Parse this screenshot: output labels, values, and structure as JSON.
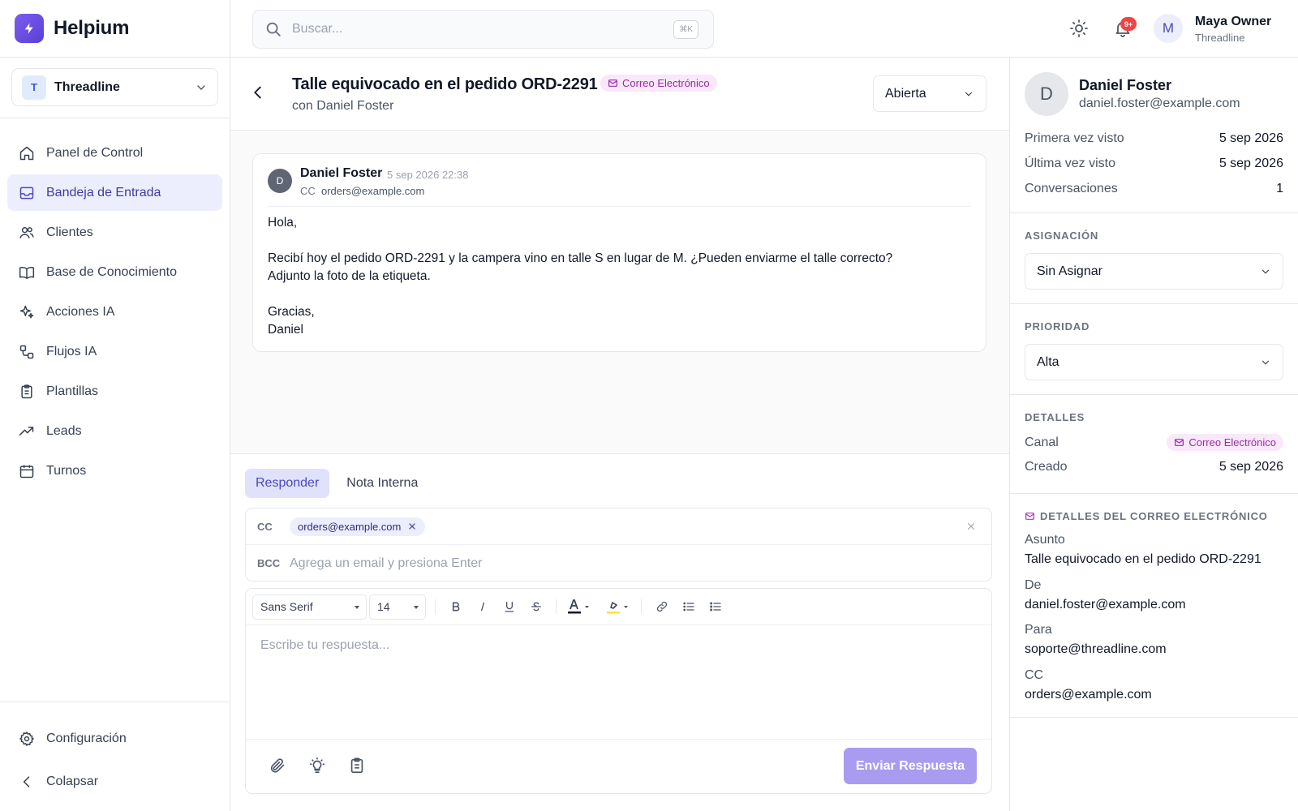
{
  "brand": {
    "name": "Helpium",
    "icon": "bolt-icon",
    "color": "#6d4ce6"
  },
  "workspace": {
    "initial": "T",
    "name": "Threadline"
  },
  "sidebar": {
    "items": [
      {
        "label": "Panel de Control",
        "icon": "home-icon"
      },
      {
        "label": "Bandeja de Entrada",
        "icon": "inbox-icon",
        "active": true
      },
      {
        "label": "Clientes",
        "icon": "users-icon"
      },
      {
        "label": "Base de Conocimiento",
        "icon": "book-icon"
      },
      {
        "label": "Acciones IA",
        "icon": "sparkles-icon"
      },
      {
        "label": "Flujos IA",
        "icon": "workflow-icon"
      },
      {
        "label": "Plantillas",
        "icon": "clipboard-icon"
      },
      {
        "label": "Leads",
        "icon": "trending-up-icon"
      },
      {
        "label": "Turnos",
        "icon": "calendar-icon"
      }
    ],
    "bottom": [
      {
        "label": "Configuración",
        "icon": "gear-icon"
      },
      {
        "label": "Colapsar",
        "icon": "chevron-left-icon"
      }
    ]
  },
  "topbar": {
    "search_placeholder": "Buscar...",
    "search_shortcut": "⌘K",
    "notification_count": "9+",
    "user_initial": "M",
    "user_name": "Maya Owner",
    "user_org": "Threadline"
  },
  "conversation": {
    "title": "Talle equivocado en el pedido ORD-2291",
    "channel": "Correo Electrónico",
    "subtitle": "con Daniel Foster",
    "status": "Abierta"
  },
  "message": {
    "initial": "D",
    "from": "Daniel Foster",
    "time": "5 sep 2026 22:38",
    "cc_label": "CC",
    "cc": "orders@example.com",
    "body": [
      "Hola,",
      "",
      "Recibí hoy el pedido ORD-2291 y la campera vino en talle S en lugar de M. ¿Pueden enviarme el talle correcto?",
      "Adjunto la foto de la etiqueta.",
      "",
      "Gracias,",
      "Daniel"
    ]
  },
  "reply": {
    "tabs": [
      "Responder",
      "Nota Interna"
    ],
    "cc_label": "CC",
    "cc_chip": "orders@example.com",
    "bcc_label": "BCC",
    "bcc_placeholder": "Agrega un email y presiona Enter",
    "font_family": "Sans Serif",
    "font_size": "14",
    "editor_placeholder": "Escribe tu respuesta...",
    "send_label": "Enviar Respuesta",
    "accent": "#a99bf0"
  },
  "details": {
    "contact": {
      "initial": "D",
      "name": "Daniel Foster",
      "email": "daniel.foster@example.com",
      "first_seen_label": "Primera vez visto",
      "first_seen": "5 sep 2026",
      "last_seen_label": "Última vez visto",
      "last_seen": "5 sep 2026",
      "conversations_label": "Conversaciones",
      "conversations": "1"
    },
    "assignment": {
      "heading": "ASIGNACIÓN",
      "value": "Sin Asignar"
    },
    "priority": {
      "heading": "PRIORIDAD",
      "value": "Alta"
    },
    "info": {
      "heading": "DETALLES",
      "channel_label": "Canal",
      "channel": "Correo Electrónico",
      "created_label": "Creado",
      "created": "5 sep 2026"
    },
    "email": {
      "heading": "DETALLES DEL CORREO ELECTRÓNICO",
      "subject_label": "Asunto",
      "subject": "Talle equivocado en el pedido ORD-2291",
      "from_label": "De",
      "from": "daniel.foster@example.com",
      "to_label": "Para",
      "to": "soporte@threadline.com",
      "cc_label": "CC",
      "cc": "orders@example.com"
    }
  }
}
